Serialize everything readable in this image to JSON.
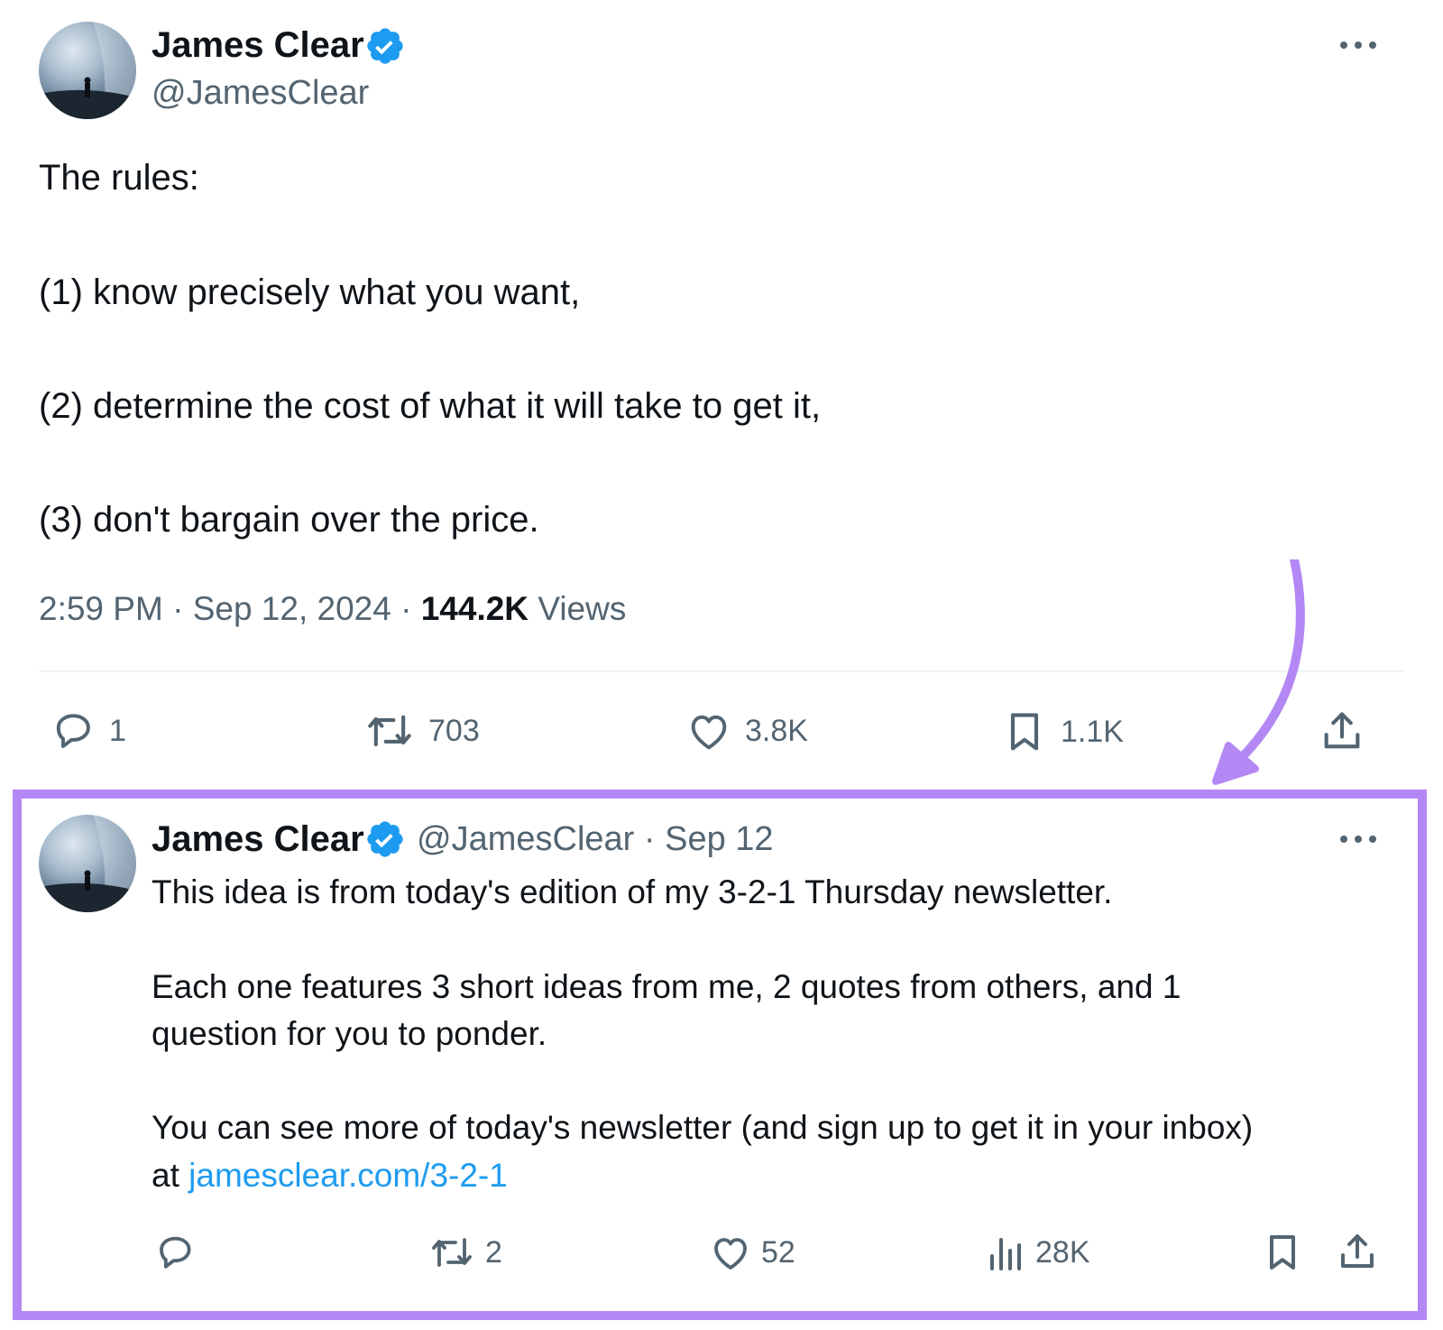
{
  "main_tweet": {
    "author_name": "James Clear",
    "author_handle": "@JamesClear",
    "lines": [
      "The rules:",
      "(1) know precisely what you want,",
      "(2) determine the cost of what it will take to get it,",
      "(3) don't bargain over the price."
    ],
    "time": "2:59 PM",
    "date": "Sep 12, 2024",
    "views_count": "144.2K",
    "views_label": "Views",
    "separator": "·",
    "actions": {
      "replies": "1",
      "reposts": "703",
      "likes": "3.8K",
      "bookmarks": "1.1K"
    }
  },
  "reply_tweet": {
    "author_name": "James Clear",
    "author_handle": "@JamesClear",
    "date": "Sep 12",
    "separator": "·",
    "paragraph1": "This idea is from today's edition of my 3-2-1 Thursday newsletter.",
    "paragraph2_line1": "Each one features 3 short ideas from me, 2 quotes from others, and 1",
    "paragraph2_line2": "question for you to ponder.",
    "paragraph3_line1": "You can see more of today's newsletter (and sign up to get it in your inbox)",
    "paragraph3_prefix": "at",
    "link_text": "jamesclear.com/3-2-1",
    "actions": {
      "reposts": "2",
      "likes": "52",
      "views": "28K"
    }
  },
  "colors": {
    "highlight": "#b388f5",
    "verified": "#1d9bf0",
    "link": "#1d9bf0",
    "secondary_text": "#536471"
  },
  "icons": [
    "more-icon",
    "verified-badge-icon",
    "reply-icon",
    "repost-icon",
    "like-icon",
    "bookmark-icon",
    "share-icon",
    "views-icon",
    "arrow-icon"
  ]
}
